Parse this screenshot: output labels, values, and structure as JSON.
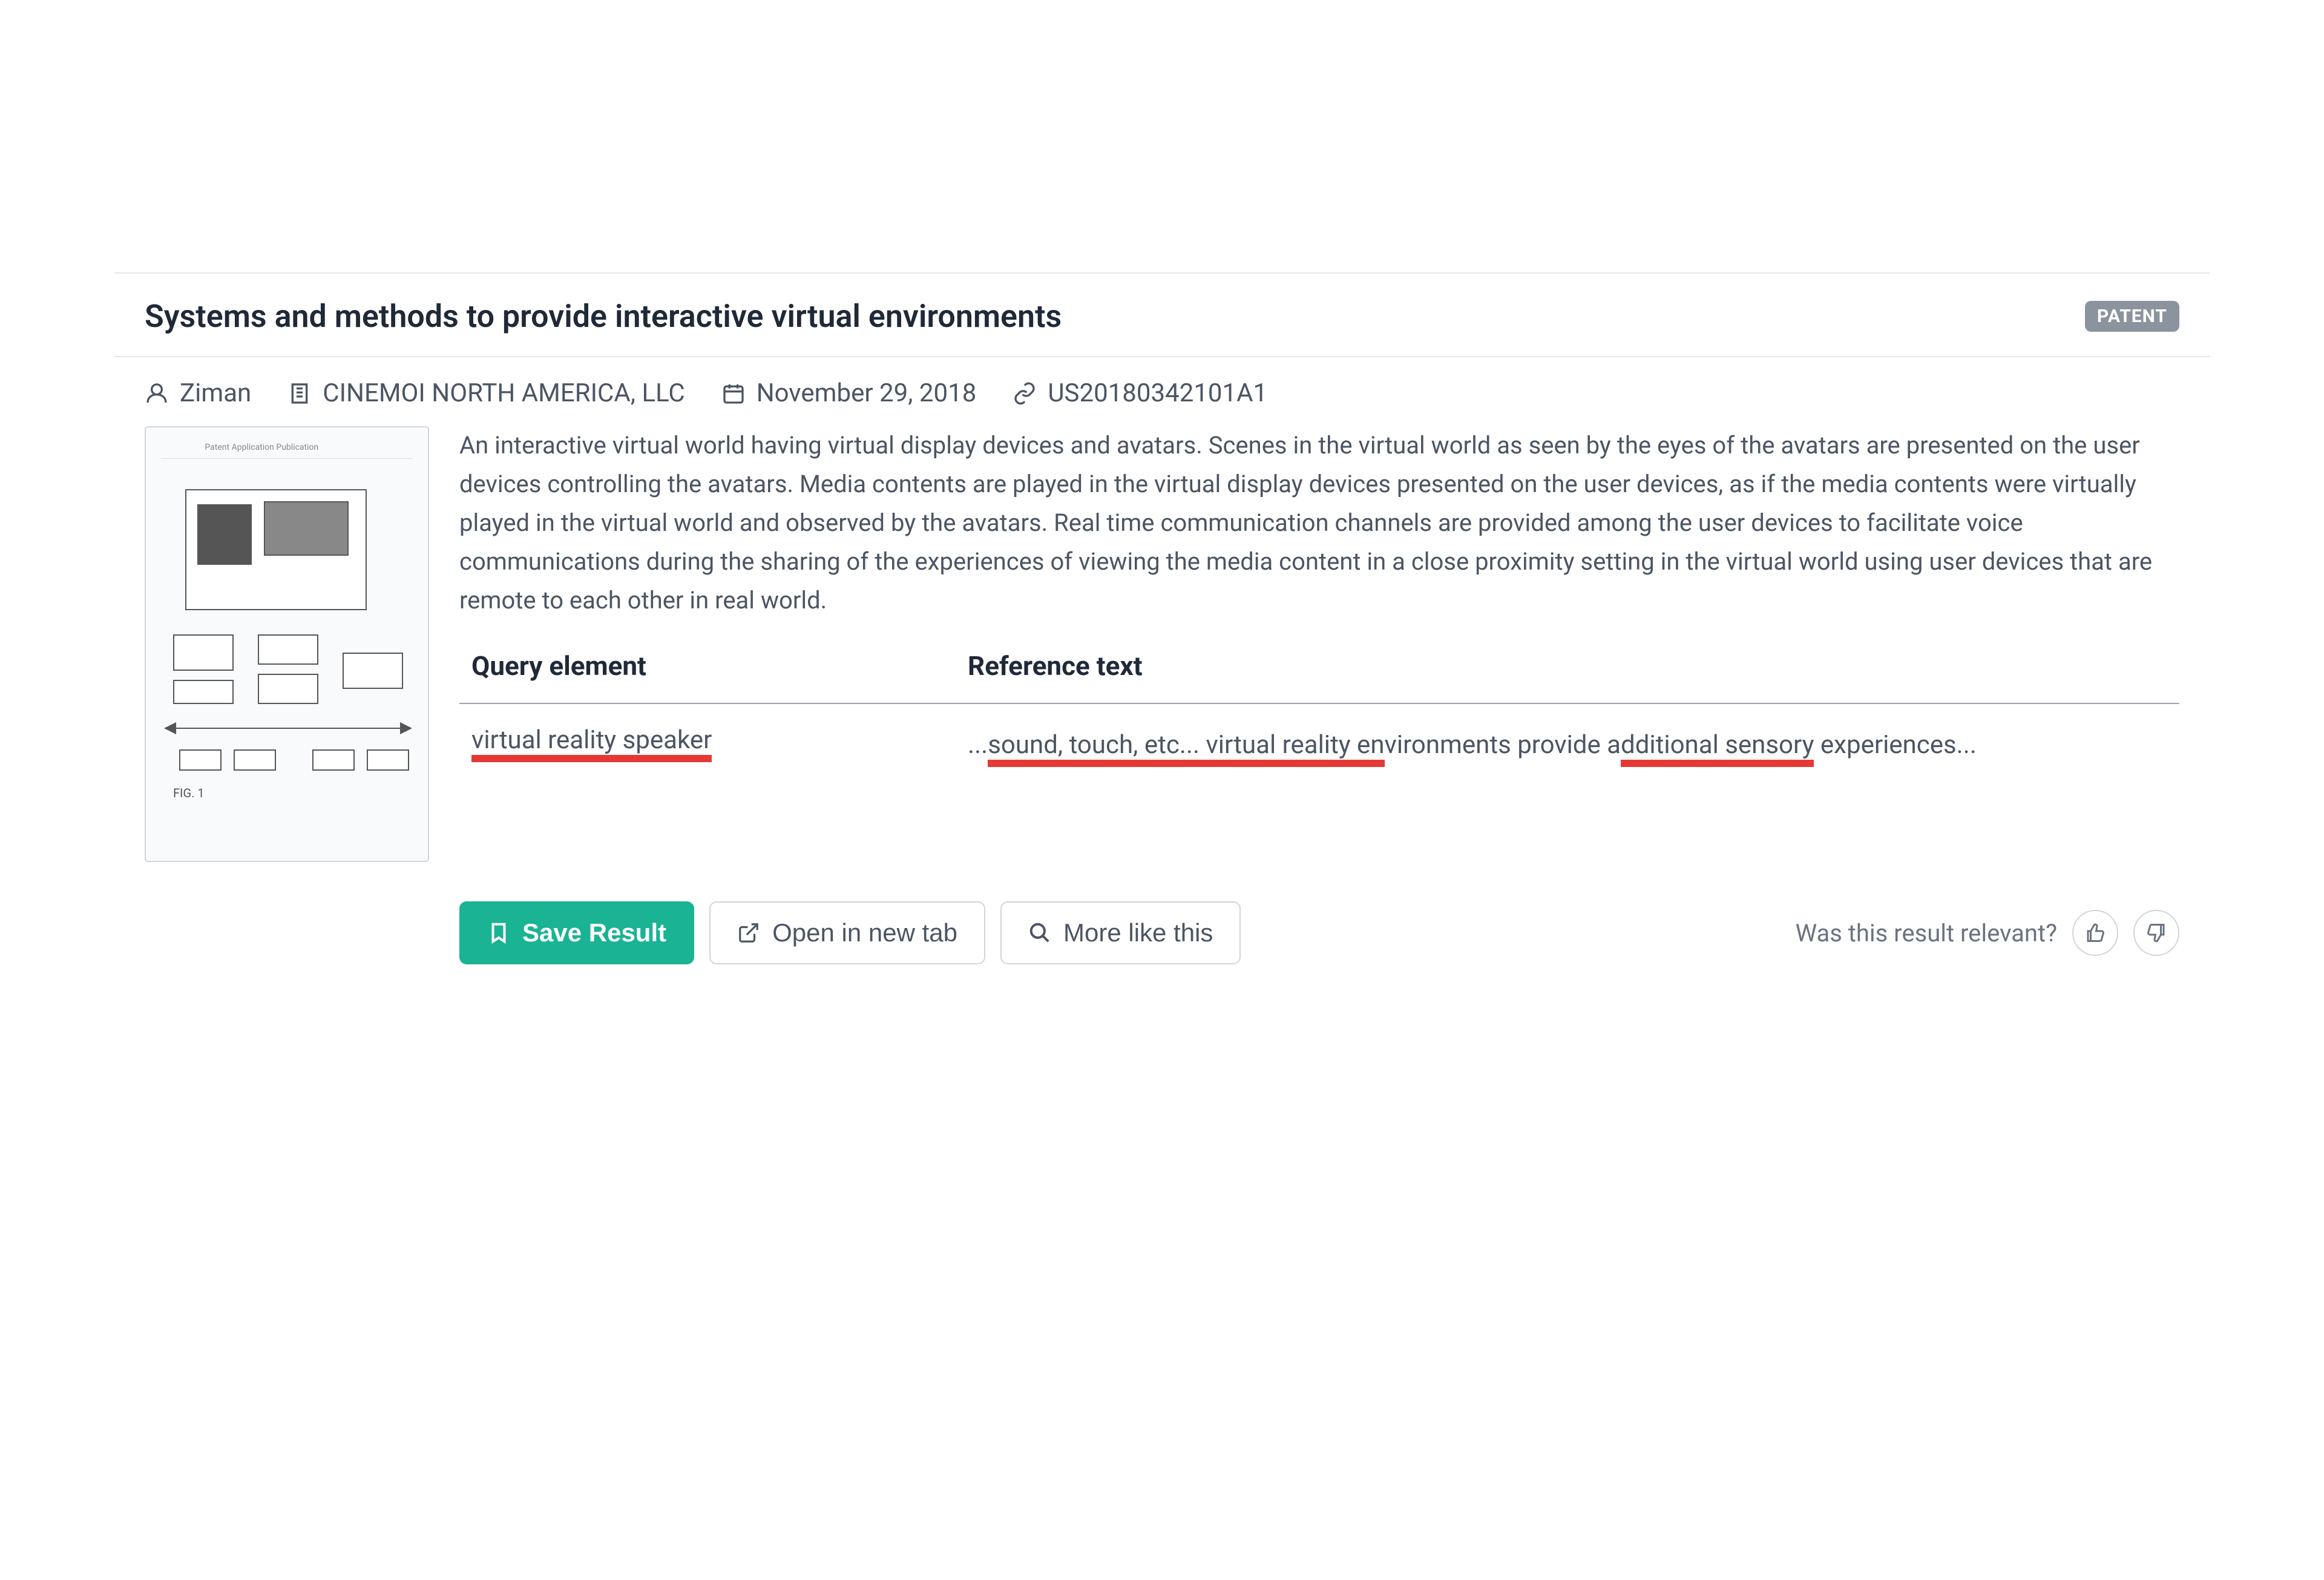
{
  "result": {
    "title": "Systems and methods to provide interactive virtual environments",
    "badge": "PATENT",
    "author": "Ziman",
    "assignee": "CINEMOI NORTH AMERICA, LLC",
    "date": "November 29, 2018",
    "patent_number": "US20180342101A1",
    "abstract": "An interactive virtual world having virtual display devices and avatars. Scenes in the virtual world as seen by the eyes of the avatars are presented on the user devices controlling the avatars. Media contents are played in the virtual display devices presented on the user devices, as if the media contents were virtually played in the virtual world and observed by the avatars. Real time communication channels are provided among the user devices to facilitate voice communications during the sharing of the experiences of viewing the media content in a close proximity setting in the virtual world using user devices that are remote to each other in real world."
  },
  "table": {
    "header_query": "Query element",
    "header_ref": "Reference text",
    "row": {
      "query": "virtual reality speaker",
      "ref_prefix": "...",
      "ref_hl1": "sound, touch, etc... virtual reality en",
      "ref_mid1": "vironments provide a",
      "ref_hl2": "dditional sensory",
      "ref_suffix": " experiences..."
    }
  },
  "actions": {
    "save": "Save Result",
    "open": "Open in new tab",
    "morelike": "More like this"
  },
  "feedback": {
    "question": "Was this result relevant?"
  }
}
